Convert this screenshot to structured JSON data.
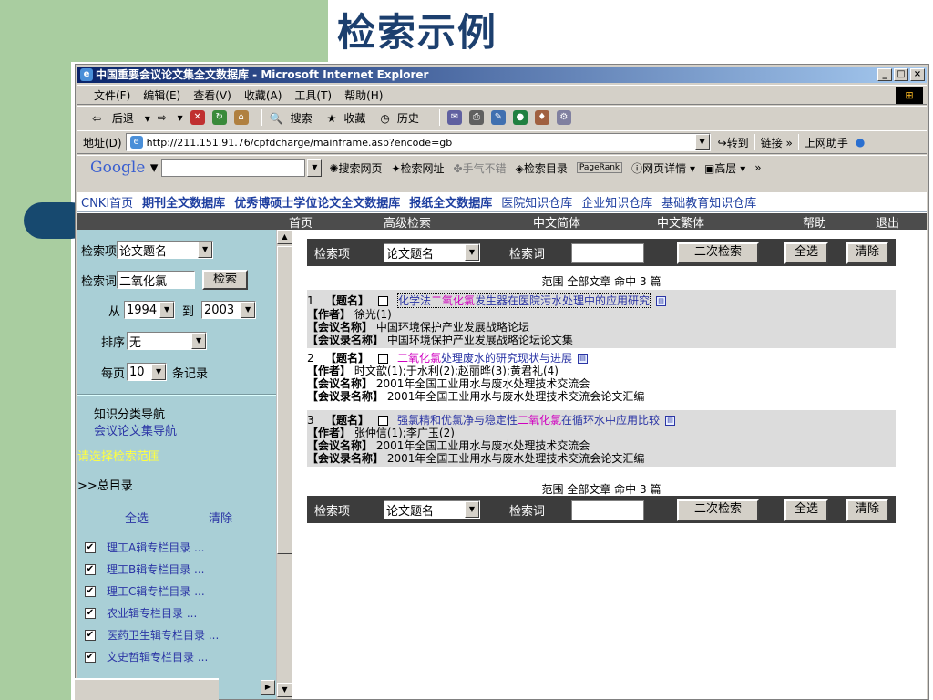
{
  "slide": {
    "title": "检索示例"
  },
  "window": {
    "title": "中国重要会议论文集全文数据库 - Microsoft Internet Explorer",
    "controls": [
      "_",
      "□",
      "×"
    ]
  },
  "menu": [
    "文件(F)",
    "编辑(E)",
    "查看(V)",
    "收藏(A)",
    "工具(T)",
    "帮助(H)"
  ],
  "toolbar": {
    "back": "后退",
    "search": "搜索",
    "favorites": "收藏",
    "history": "历史"
  },
  "address": {
    "label": "地址(D)",
    "url": "http://211.151.91.76/cpfdcharge/mainframe.asp?encode=gb",
    "go": "转到",
    "links": "链接",
    "assistant": "上网助手"
  },
  "google": {
    "logo": "Google",
    "search_web": "搜索网页",
    "search_site": "检索网址",
    "lucky": "手气不错",
    "directory": "检索目录",
    "pagerank": "PageRank",
    "page_info": "网页详情",
    "up": "高层"
  },
  "cnki_nav": [
    "CNKI首页",
    "期刊全文数据库",
    "优秀博硕士学位论文全文数据库",
    "报纸全文数据库",
    "医院知识仓库",
    "企业知识仓库",
    "基础教育知识仓库"
  ],
  "site_menu": [
    "首页",
    "高级检索",
    "中文简体",
    "中文繁体",
    "帮助",
    "退出"
  ],
  "left": {
    "field_label": "检索项",
    "field_value": "论文题名",
    "term_label": "检索词",
    "term_value": "二氧化氯",
    "search_btn": "检索",
    "from_label": "从",
    "from_year": "1994",
    "to_label": "到",
    "to_year": "2003",
    "sort_label": "排序",
    "sort_value": "无",
    "perpage_label": "每页",
    "perpage_value": "10",
    "perpage_unit": "条记录",
    "nav_title": "知识分类导航",
    "nav_link": "会议论文集导航",
    "range_prompt": "请选择检索范围",
    "catalog": ">>总目录",
    "select_all": "全选",
    "clear": "清除",
    "categories": [
      "理工A辑专栏目录 ...",
      "理工B辑专栏目录 ...",
      "理工C辑专栏目录 ...",
      "农业辑专栏目录 ...",
      "医药卫生辑专栏目录 ...",
      "文史哲辑专栏目录 ..."
    ]
  },
  "searchbar": {
    "field_label": "检索项",
    "field_value": "论文题名",
    "term_label": "检索词",
    "secondary": "二次检索",
    "select_all": "全选",
    "clear": "清除"
  },
  "summary": "范围  全部文章 命中 3 篇",
  "results": [
    {
      "num": "1",
      "title_tag": "【题名】",
      "title_pre": "化学法",
      "title_hl": "二氧化氯",
      "title_post": "发生器在医院污水处理中的应用研究",
      "author_tag": "【作者】",
      "authors": "徐光(1)",
      "conf_tag": "【会议名称】",
      "conf": "中国环境保护产业发展战略论坛",
      "proc_tag": "【会议录名称】",
      "proc": "中国环境保护产业发展战略论坛论文集"
    },
    {
      "num": "2",
      "title_tag": "【题名】",
      "title_pre": "",
      "title_hl": "二氧化氯",
      "title_post": "处理废水的研究现状与进展",
      "author_tag": "【作者】",
      "authors": "时文歆(1);于水利(2);赵丽晔(3);黄君礼(4)",
      "conf_tag": "【会议名称】",
      "conf": "2001年全国工业用水与废水处理技术交流会",
      "proc_tag": "【会议录名称】",
      "proc": "2001年全国工业用水与废水处理技术交流会论文汇编"
    },
    {
      "num": "3",
      "title_tag": "【题名】",
      "title_pre": "强氯精和优氯净与稳定性",
      "title_hl": "二氧化氯",
      "title_post": "在循环水中应用比较",
      "author_tag": "【作者】",
      "authors": "张仲信(1);李广玉(2)",
      "conf_tag": "【会议名称】",
      "conf": "2001年全国工业用水与废水处理技术交流会",
      "proc_tag": "【会议录名称】",
      "proc": "2001年全国工业用水与废水处理技术交流会论文汇编"
    }
  ]
}
